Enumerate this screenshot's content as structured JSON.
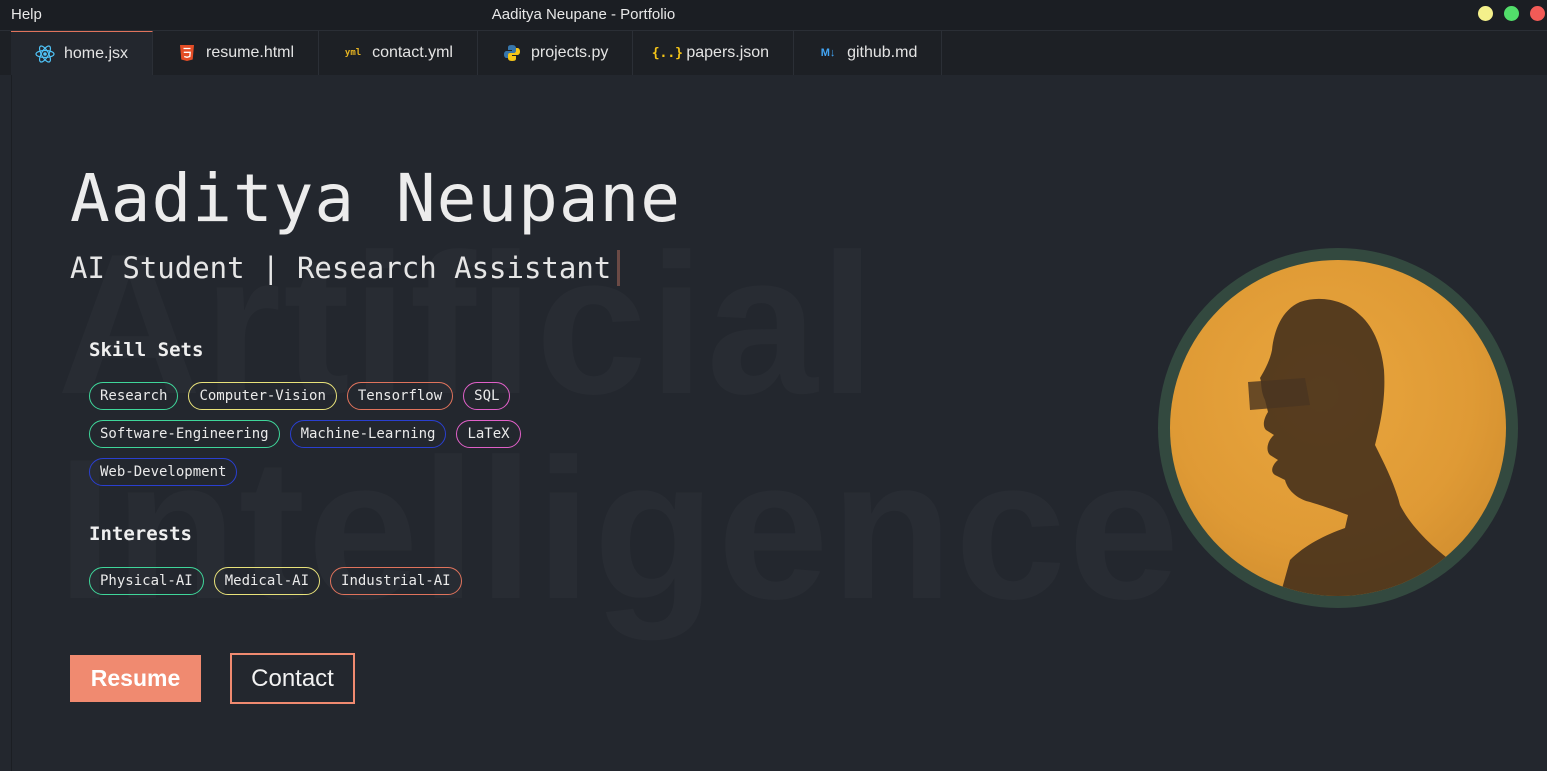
{
  "window": {
    "menu_help": "Help",
    "title": "Aaditya Neupane - Portfolio"
  },
  "tabs": [
    {
      "label": "home.jsx",
      "icon": "react-icon",
      "icon_color": "#4fc3f7",
      "active": true
    },
    {
      "label": "resume.html",
      "icon": "html5-icon",
      "icon_color": "#e44d26",
      "active": false
    },
    {
      "label": "contact.yml",
      "icon": "yaml-icon",
      "icon_color": "#e6b422",
      "active": false
    },
    {
      "label": "projects.py",
      "icon": "python-icon",
      "icon_color": "#3776ab",
      "active": false
    },
    {
      "label": "papers.json",
      "icon": "json-icon",
      "icon_color": "#f5c518",
      "active": false
    },
    {
      "label": "github.md",
      "icon": "markdown-icon",
      "icon_color": "#42a5f5",
      "active": false
    }
  ],
  "hero": {
    "watermark_line1": "Artificial",
    "watermark_line2": "Intelligence",
    "name": "Aaditya Neupane",
    "tagline": "AI Student | Research Assistant"
  },
  "skills": {
    "title": "Skill Sets",
    "items": [
      {
        "label": "Research",
        "color": "#3fd69a"
      },
      {
        "label": "Computer-Vision",
        "color": "#e8e27a"
      },
      {
        "label": "Tensorflow",
        "color": "#e0735c"
      },
      {
        "label": "SQL",
        "color": "#e060c8"
      },
      {
        "label": "Software-Engineering",
        "color": "#3fd69a"
      },
      {
        "label": "Machine-Learning",
        "color": "#2a3fd0"
      },
      {
        "label": "LaTeX",
        "color": "#e060c8"
      },
      {
        "label": "Web-Development",
        "color": "#2a3fd0"
      }
    ]
  },
  "interests": {
    "title": "Interests",
    "items": [
      {
        "label": "Physical-AI",
        "color": "#3fd69a"
      },
      {
        "label": "Medical-AI",
        "color": "#e8e27a"
      },
      {
        "label": "Industrial-AI",
        "color": "#e0735c"
      }
    ]
  },
  "actions": {
    "resume_label": "Resume",
    "contact_label": "Contact",
    "accent": "#f08a70"
  }
}
